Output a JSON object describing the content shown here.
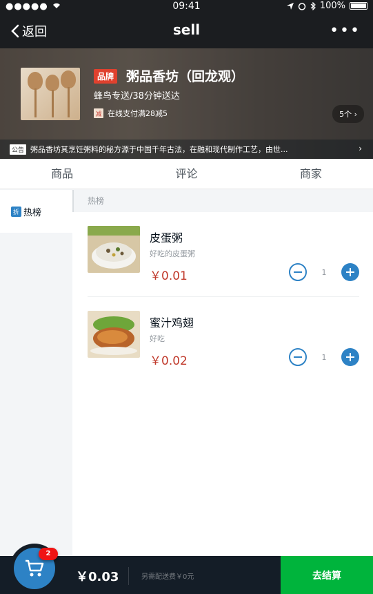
{
  "status_bar": {
    "carrier": "●●●●● ",
    "time": "09:41",
    "battery": "100%"
  },
  "nav": {
    "back_label": "返回",
    "title": "sell"
  },
  "seller": {
    "brand_badge": "品牌",
    "name": "粥品香坊（回龙观）",
    "delivery": "蜂鸟专送/38分钟送达",
    "promo_icon": "减",
    "promo_text": "在线支付满28减5",
    "supports_count": "5个 ›",
    "bulletin_tag": "公告",
    "bulletin": "粥品香坊其烹饪粥料的秘方源于中国千年古法，在融和现代制作工艺，由世..."
  },
  "tabs": [
    {
      "label": "商品"
    },
    {
      "label": "评论"
    },
    {
      "label": "商家"
    }
  ],
  "menu": [
    {
      "icon": "折",
      "label": "热榜"
    }
  ],
  "section": {
    "title": "热榜"
  },
  "foods": [
    {
      "name": "皮蛋粥",
      "description": "好吃的皮蛋粥",
      "price": "￥0.01",
      "count": "1"
    },
    {
      "name": "蜜汁鸡翅",
      "description": "好吃",
      "price": "￥0.02",
      "count": "1"
    }
  ],
  "cart": {
    "count": "2",
    "total_price": "￥0.03",
    "delivery_desc": "另需配送费￥0元",
    "pay_label": "去结算"
  },
  "colors": {
    "primary": "#2d82c5",
    "price": "#c0392b",
    "pay": "#00b43c",
    "badge": "#f01414"
  }
}
